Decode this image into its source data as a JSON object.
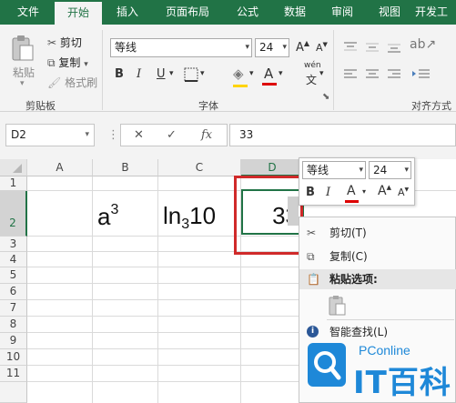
{
  "tabs": [
    "文件",
    "开始",
    "插入",
    "页面布局",
    "公式",
    "数据",
    "审阅",
    "视图",
    "开发工"
  ],
  "clipboard": {
    "paste": "粘贴",
    "cut": "剪切",
    "copy": "复制",
    "format_painter": "格式刷",
    "group_label": "剪贴板"
  },
  "font": {
    "name": "等线",
    "size": "24",
    "group_label": "字体",
    "phonetic_top": "wén",
    "phonetic_bottom": "文"
  },
  "alignment": {
    "group_label": "对齐方式"
  },
  "formula_bar": {
    "name_box": "D2",
    "value": "33",
    "fx": "fx"
  },
  "columns": [
    "A",
    "B",
    "C",
    "D"
  ],
  "rows": [
    "1",
    "2",
    "3",
    "4",
    "5",
    "6",
    "7",
    "8",
    "9",
    "10",
    "11"
  ],
  "cells": {
    "b2_base": "a",
    "b2_sup": "3",
    "c2_main": "ln",
    "c2_sub": "3",
    "c2_tail": "10",
    "d2_value": "33"
  },
  "mini_toolbar": {
    "font_name": "等线",
    "font_size": "24",
    "bold": "B",
    "italic": "I",
    "font_color": "A",
    "grow": "A",
    "shrink": "A"
  },
  "context_menu": {
    "items": [
      {
        "label": "剪切(T)"
      },
      {
        "label": "复制(C)"
      },
      {
        "label": "粘贴选项:"
      },
      {
        "label": "智能查找(L)"
      }
    ]
  },
  "watermark": {
    "brand": "PConline",
    "name": "IT百科"
  },
  "colors": {
    "excel_green": "#217346",
    "highlight_red": "#d02a2a",
    "font_red": "#dd0000"
  }
}
